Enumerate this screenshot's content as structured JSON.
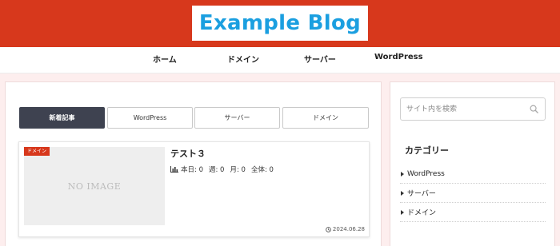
{
  "header": {
    "logo_text": "Example Blog",
    "bg_color": "#d7381c",
    "logo_color": "#1b9fe0"
  },
  "nav": {
    "items": [
      {
        "label": "ホーム"
      },
      {
        "label": "ドメイン"
      },
      {
        "label": "サーバー"
      },
      {
        "label": "WordPress"
      }
    ]
  },
  "tabs": {
    "items": [
      {
        "label": "新着記事",
        "active": true
      },
      {
        "label": "WordPress",
        "active": false
      },
      {
        "label": "サーバー",
        "active": false
      },
      {
        "label": "ドメイン",
        "active": false
      }
    ]
  },
  "post": {
    "category_badge": "ドメイン",
    "thumbnail_text": "NO IMAGE",
    "title": "テスト３",
    "pv_icon": "bar-chart-icon",
    "pv": {
      "today": "本日: 0",
      "week": "週: 0",
      "month": "月: 0",
      "total": "全体: 0"
    },
    "date_icon": "clock-icon",
    "date": "2024.06.28"
  },
  "sidebar": {
    "search": {
      "placeholder": "サイト内を検索",
      "icon": "search-icon"
    },
    "category_heading": "カテゴリー",
    "categories": [
      {
        "label": "WordPress"
      },
      {
        "label": "サーバー"
      },
      {
        "label": "ドメイン"
      }
    ]
  }
}
